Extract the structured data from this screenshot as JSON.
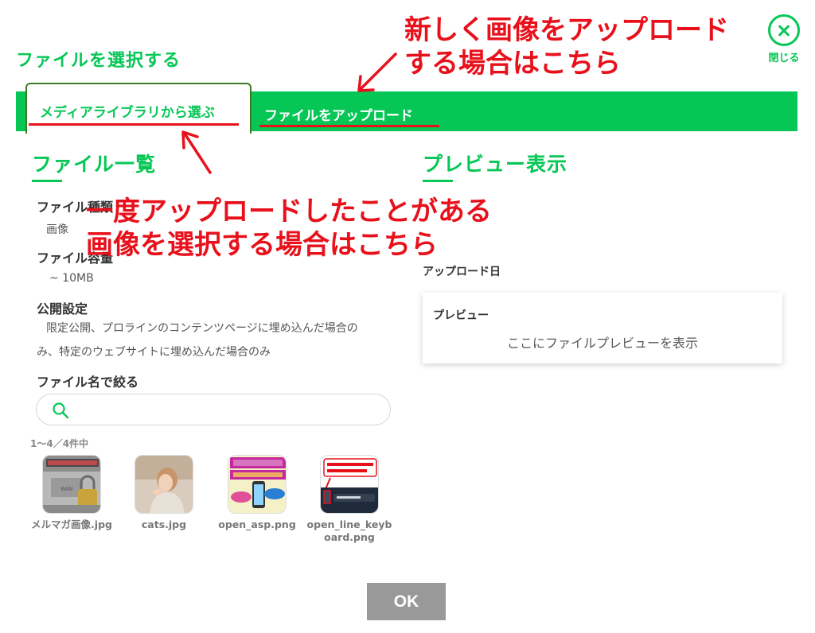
{
  "modal": {
    "title": "ファイルを選択する",
    "close_label": "閉じる"
  },
  "tabs": [
    {
      "label": "メディアライブラリから選ぶ",
      "active": true
    },
    {
      "label": "ファイルをアップロード",
      "active": false
    }
  ],
  "file_list": {
    "title": "ファイル一覧",
    "file_type_label": "ファイル種類",
    "file_type_value": "画像",
    "file_size_label": "ファイル容量",
    "file_size_value": "~ 10MB",
    "visibility_label": "公開設定",
    "visibility_desc_line1": "限定公開、プロラインのコンテンツページに埋め込んだ場合の",
    "visibility_desc_line2": "み、特定のウェブサイトに埋め込んだ場合のみ",
    "filter_label": "ファイル名で絞る",
    "search_placeholder": "",
    "count_text": "1～4／4件中",
    "files": [
      {
        "name": "メルマガ画像.jpg",
        "thumb_icon": "padlock-image"
      },
      {
        "name": "cats.jpg",
        "thumb_icon": "woman-photo"
      },
      {
        "name": "open_asp.png",
        "thumb_icon": "promo-banner"
      },
      {
        "name": "open_line_keyboard.png",
        "thumb_icon": "keyboard-screenshot"
      }
    ]
  },
  "preview": {
    "title": "プレビュー表示",
    "upload_date_label": "アップロード日",
    "card_title": "プレビュー",
    "card_text": "ここにファイルプレビューを表示"
  },
  "ok_label": "OK",
  "annotations": {
    "upload_note_line1": "新しく画像をアップロード",
    "upload_note_line2": "する場合はこちら",
    "select_note_line1": "一度アップロードしたことがある",
    "select_note_line2": "画像を選択する場合はこちら"
  },
  "colors": {
    "brand_green": "#06c755",
    "annotation_red": "#e8111b",
    "ok_gray": "#999999"
  }
}
